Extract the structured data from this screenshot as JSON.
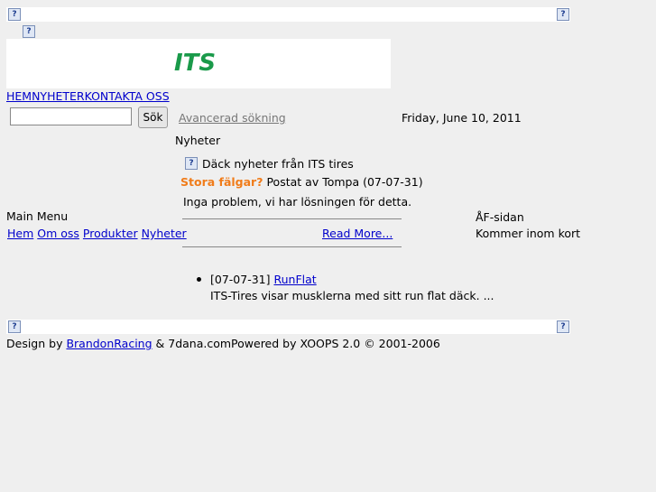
{
  "header": {
    "logo_text": "ITS",
    "nav": [
      "HEMNYHETERKONTAKTA OSS"
    ]
  },
  "search": {
    "value": "",
    "button_label": "Sök",
    "advanced_link": "Avancerad sökning"
  },
  "date": "Friday, June 10, 2011",
  "news_section": {
    "heading": "Nyheter",
    "feed_title": "Däck nyheter från ITS tires",
    "article": {
      "title": "Stora fälgar?",
      "byline": "Postat av Tompa (07-07-31)",
      "body": "Inga problem, vi har lösningen för detta.",
      "read_more": "Read More..."
    },
    "list_item": {
      "date": "[07-07-31]",
      "link": "RunFlat",
      "summary": "ITS-Tires visar musklerna med sitt run flat däck. ..."
    }
  },
  "main_menu": {
    "title": "Main Menu",
    "links": [
      "Hem",
      "Om oss",
      "Produkter",
      "Nyheter"
    ]
  },
  "right_block": {
    "title": "ÅF-sidan",
    "text": "Kommer inom kort"
  },
  "footer": {
    "design_by": "Design by",
    "brandon": "BrandonRacing",
    "rest": "& 7dana.comPowered by XOOPS 2.0 © 2001-2006"
  },
  "colors": {
    "logo": "#1a9a4a",
    "article_title": "#f07c1a",
    "link": "#0000cc"
  }
}
